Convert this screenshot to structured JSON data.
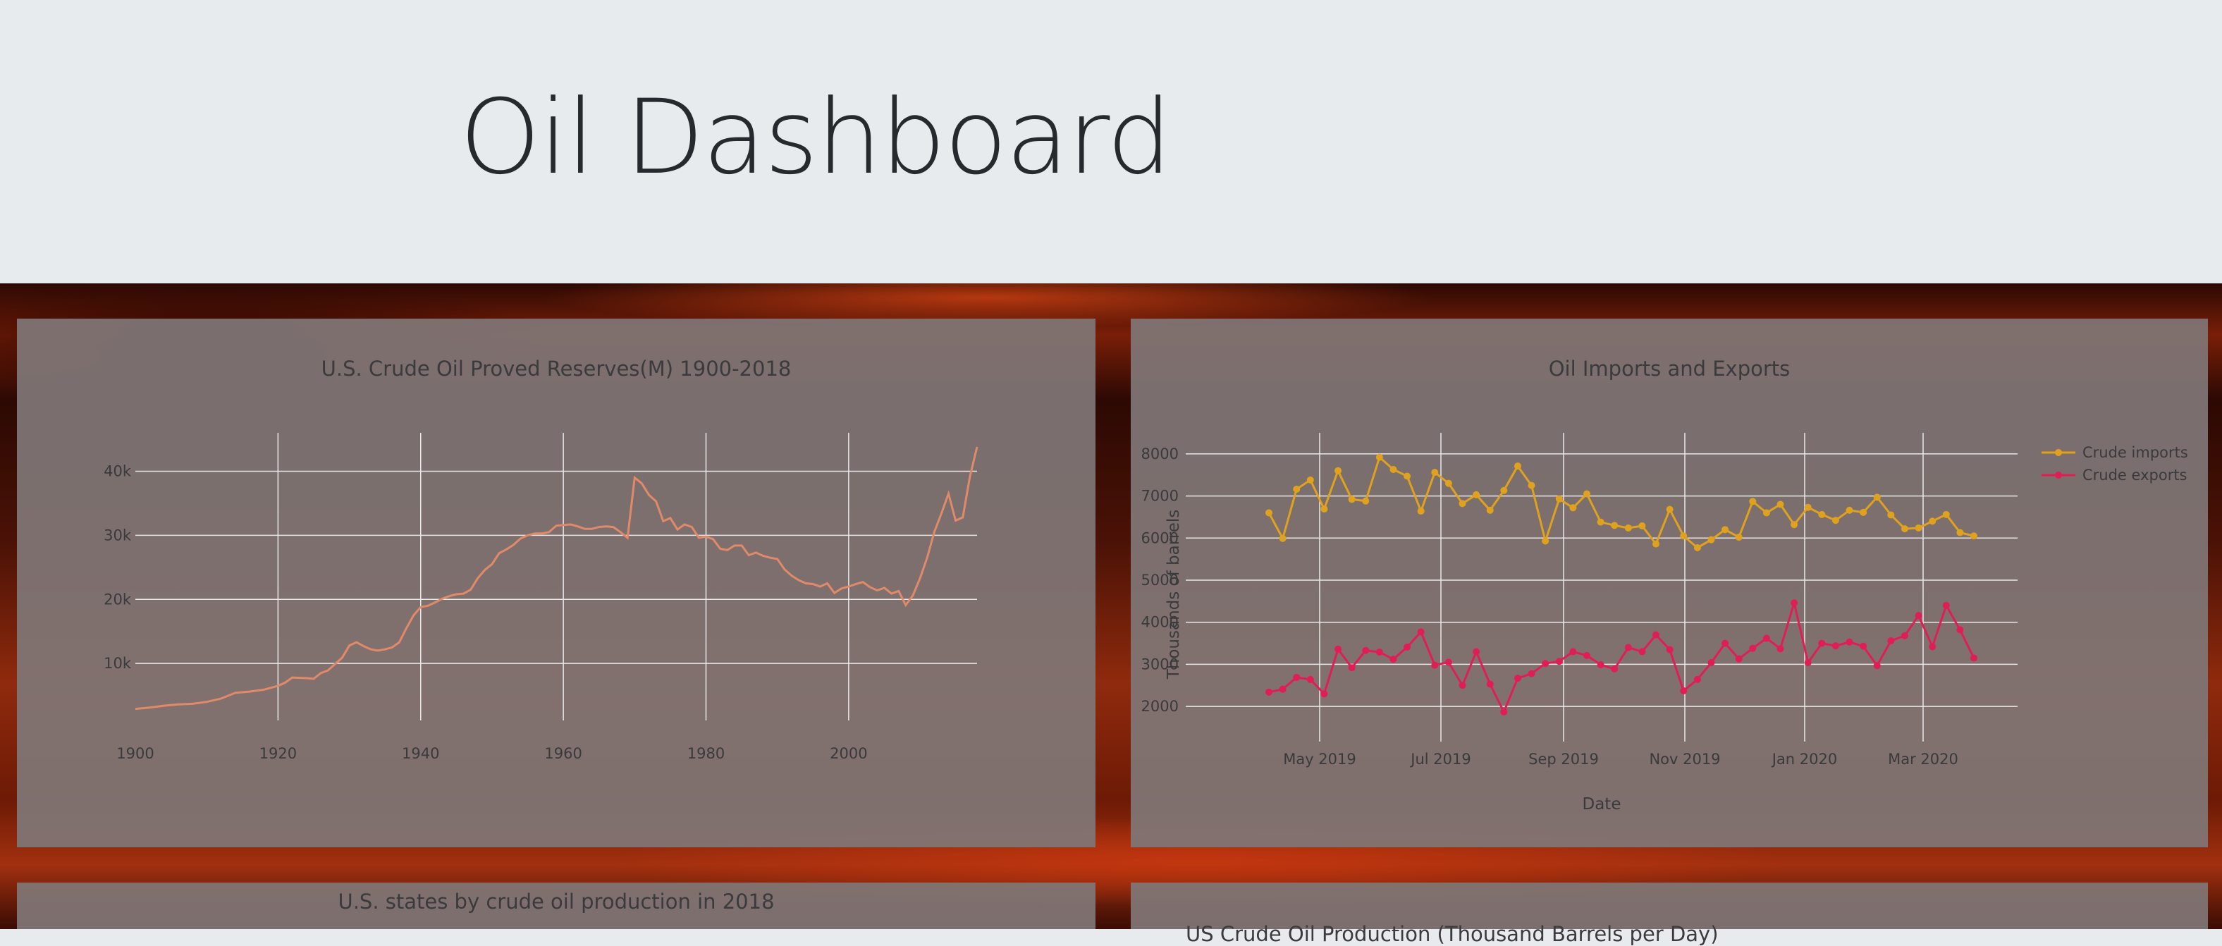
{
  "page": {
    "title": "Oil Dashboard"
  },
  "colors": {
    "reserves": "#e08a6a",
    "imports": "#e0a21e",
    "exports": "#e01e55",
    "grid": "#e8e8e8"
  },
  "panels": {
    "reserves": {
      "title": "U.S. Crude Oil Proved Reserves(M) 1900-2018"
    },
    "trade": {
      "title": "Oil Imports and Exports"
    },
    "states": {
      "title": "U.S. states by crude oil production in 2018"
    },
    "production": {
      "title": "US Crude Oil Production (Thousand Barrels per Day)"
    }
  },
  "chart_data": [
    {
      "type": "line",
      "title": "U.S. Crude Oil Proved Reserves(M) 1900-2018",
      "xlim": [
        1900,
        2018
      ],
      "ylim": [
        0,
        46000
      ],
      "xticks": [
        1900,
        1920,
        1940,
        1960,
        1980,
        2000
      ],
      "xtick_labels": [
        "1900",
        "1920",
        "1940",
        "1960",
        "1980",
        "2000"
      ],
      "yticks": [
        10000,
        20000,
        30000,
        40000
      ],
      "ytick_labels": [
        "10k",
        "20k",
        "30k",
        "40k"
      ],
      "grid": true,
      "series": [
        {
          "x": [
            1900,
            1902,
            1904,
            1906,
            1908,
            1910,
            1912,
            1914,
            1916,
            1918,
            1920,
            1921,
            1922,
            1924,
            1925,
            1926,
            1927,
            1928,
            1929,
            1930,
            1931,
            1932,
            1933,
            1934,
            1935,
            1936,
            1937,
            1938,
            1939,
            1940,
            1941,
            1942,
            1943,
            1944,
            1945,
            1946,
            1947,
            1948,
            1949,
            1950,
            1951,
            1952,
            1953,
            1954,
            1955,
            1956,
            1957,
            1958,
            1959,
            1960,
            1961,
            1962,
            1963,
            1964,
            1965,
            1966,
            1967,
            1968,
            1969,
            1970,
            1971,
            1972,
            1973,
            1974,
            1975,
            1976,
            1977,
            1978,
            1979,
            1980,
            1981,
            1982,
            1983,
            1984,
            1985,
            1986,
            1987,
            1988,
            1989,
            1990,
            1991,
            1992,
            1993,
            1994,
            1995,
            1996,
            1997,
            1998,
            1999,
            2000,
            2001,
            2002,
            2003,
            2004,
            2005,
            2006,
            2007,
            2008,
            2009,
            2010,
            2011,
            2012,
            2013,
            2014,
            2015,
            2016,
            2017,
            2018
          ],
          "values": [
            2900,
            3100,
            3400,
            3600,
            3700,
            4000,
            4500,
            5400,
            5600,
            5900,
            6500,
            7000,
            7800,
            7700,
            7600,
            8500,
            8900,
            9900,
            10900,
            12800,
            13300,
            12700,
            12200,
            12000,
            12200,
            12500,
            13300,
            15500,
            17500,
            18800,
            19000,
            19500,
            20100,
            20500,
            20800,
            20900,
            21500,
            23300,
            24600,
            25500,
            27200,
            27800,
            28500,
            29500,
            30000,
            30300,
            30300,
            30500,
            31500,
            31600,
            31700,
            31400,
            31000,
            31000,
            31300,
            31400,
            31300,
            30500,
            29600,
            39000,
            38100,
            36300,
            35300,
            32200,
            32700,
            30900,
            31700,
            31300,
            29600,
            29800,
            29400,
            27900,
            27700,
            28400,
            28400,
            26900,
            27300,
            26800,
            26500,
            26300,
            24700,
            23700,
            23000,
            22500,
            22400,
            22000,
            22500,
            21000,
            21700,
            22000,
            22400,
            22700,
            21900,
            21400,
            21800,
            20900,
            21300,
            19100,
            20600,
            23300,
            26500,
            30500,
            33400,
            36500,
            32300,
            32800,
            39200,
            43800
          ]
        }
      ]
    },
    {
      "type": "line",
      "title": "Oil Imports and Exports",
      "xlabel": "Date",
      "ylabel": "Thousands of barrels",
      "ylim": [
        1500,
        8500
      ],
      "yticks": [
        2000,
        3000,
        4000,
        5000,
        6000,
        7000,
        8000
      ],
      "ytick_labels": [
        "2000",
        "3000",
        "4000",
        "5000",
        "6000",
        "7000",
        "8000"
      ],
      "xtick_labels": [
        "May 2019",
        "Jul 2019",
        "Sep 2019",
        "Nov 2019",
        "Jan 2020",
        "Mar 2020"
      ],
      "legend": "top-right",
      "grid": true,
      "series": [
        {
          "name": "Crude imports",
          "values": [
            6600,
            5990,
            7160,
            7380,
            6690,
            7600,
            6920,
            6880,
            7920,
            7630,
            7470,
            6640,
            7560,
            7300,
            6820,
            7030,
            6660,
            7130,
            7710,
            7250,
            5930,
            6930,
            6720,
            7050,
            6380,
            6300,
            6240,
            6290,
            5860,
            6680,
            6050,
            5770,
            5960,
            6200,
            6020,
            6870,
            6600,
            6800,
            6320,
            6730,
            6560,
            6420,
            6660,
            6610,
            6970,
            6550,
            6220,
            6240,
            6400,
            6560,
            6130,
            6050
          ]
        },
        {
          "name": "Crude exports",
          "values": [
            2340,
            2410,
            2690,
            2640,
            2300,
            3360,
            2920,
            3330,
            3290,
            3120,
            3410,
            3770,
            2980,
            3050,
            2500,
            3300,
            2530,
            1870,
            2670,
            2780,
            3020,
            3070,
            3300,
            3210,
            2990,
            2890,
            3400,
            3300,
            3700,
            3350,
            2370,
            2640,
            3040,
            3500,
            3130,
            3380,
            3620,
            3370,
            4460,
            3040,
            3500,
            3440,
            3530,
            3430,
            2970,
            3560,
            3680,
            4160,
            3420,
            4400,
            3820,
            3150
          ]
        }
      ]
    }
  ]
}
